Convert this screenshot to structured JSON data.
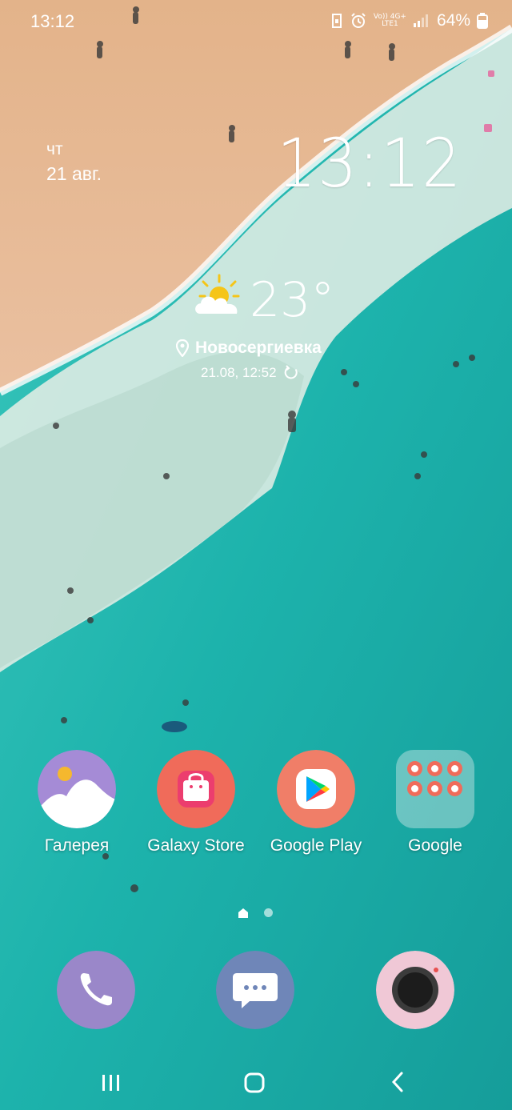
{
  "status_bar": {
    "time": "13:12",
    "network_top": "Vo)) 4G+",
    "network_bottom": "LTE1",
    "battery": "64%"
  },
  "widget": {
    "day": "чт",
    "date": "21 авг.",
    "clock": "13:12"
  },
  "weather": {
    "temperature": "23°",
    "location": "Новосергиевка",
    "updated": "21.08, 12:52"
  },
  "apps": [
    {
      "label": "Галерея",
      "icon": "gallery-icon"
    },
    {
      "label": "Galaxy Store",
      "icon": "galaxy-store-icon"
    },
    {
      "label": "Google Play",
      "icon": "google-play-icon"
    },
    {
      "label": "Google",
      "icon": "google-folder-icon"
    }
  ],
  "dock": [
    {
      "icon": "phone-icon",
      "color": "#9a87c9"
    },
    {
      "icon": "messages-icon",
      "color": "#6f86b8"
    },
    {
      "icon": "camera-icon",
      "color": "#f0c8d6"
    }
  ],
  "colors": {
    "sand": "#e8b98e",
    "sea": "#1fb3ad",
    "app_accent": "#f06b5a"
  }
}
